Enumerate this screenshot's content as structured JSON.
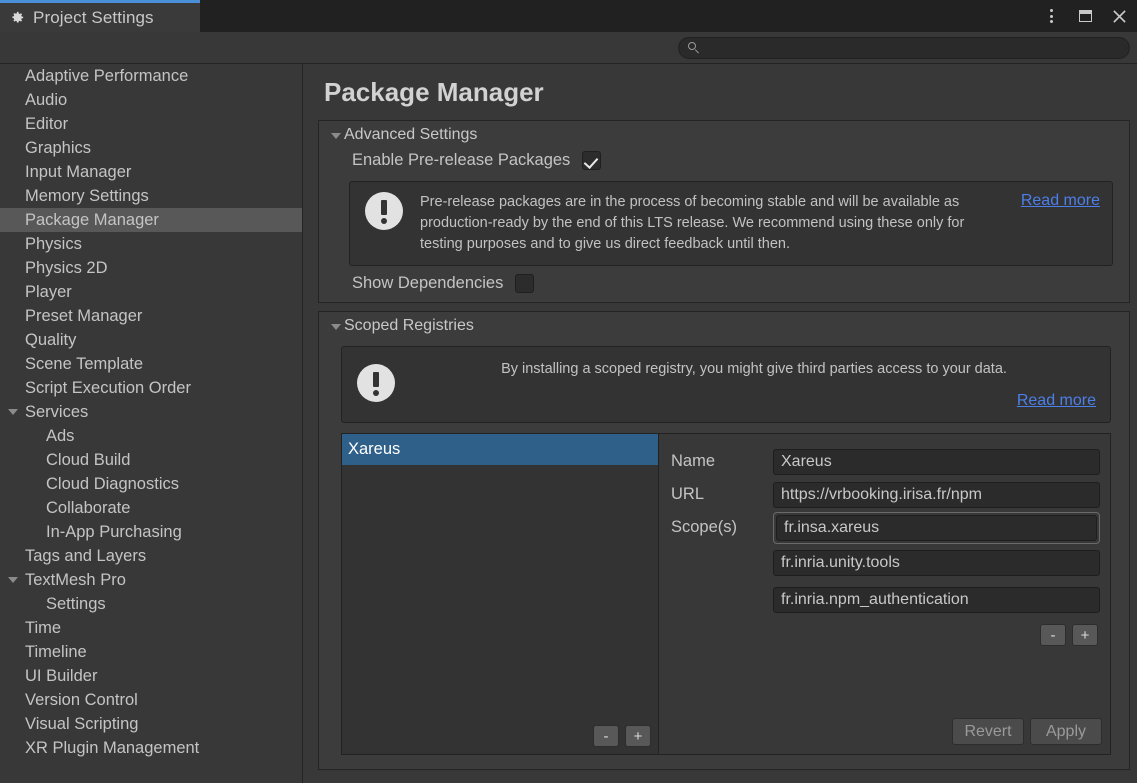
{
  "window": {
    "tab_label": "Project Settings",
    "tab_icon": "gear-icon",
    "controls": {
      "menu": "kebab-menu-icon",
      "maximize": "maximize-icon",
      "close": "close-icon"
    }
  },
  "search": {
    "icon": "search-icon",
    "value": "",
    "placeholder": ""
  },
  "sidebar": {
    "items": [
      {
        "label": "Adaptive Performance",
        "indent": 0,
        "selected": false,
        "foldout": false
      },
      {
        "label": "Audio",
        "indent": 0,
        "selected": false,
        "foldout": false
      },
      {
        "label": "Editor",
        "indent": 0,
        "selected": false,
        "foldout": false
      },
      {
        "label": "Graphics",
        "indent": 0,
        "selected": false,
        "foldout": false
      },
      {
        "label": "Input Manager",
        "indent": 0,
        "selected": false,
        "foldout": false
      },
      {
        "label": "Memory Settings",
        "indent": 0,
        "selected": false,
        "foldout": false
      },
      {
        "label": "Package Manager",
        "indent": 0,
        "selected": true,
        "foldout": false
      },
      {
        "label": "Physics",
        "indent": 0,
        "selected": false,
        "foldout": false
      },
      {
        "label": "Physics 2D",
        "indent": 0,
        "selected": false,
        "foldout": false
      },
      {
        "label": "Player",
        "indent": 0,
        "selected": false,
        "foldout": false
      },
      {
        "label": "Preset Manager",
        "indent": 0,
        "selected": false,
        "foldout": false
      },
      {
        "label": "Quality",
        "indent": 0,
        "selected": false,
        "foldout": false
      },
      {
        "label": "Scene Template",
        "indent": 0,
        "selected": false,
        "foldout": false
      },
      {
        "label": "Script Execution Order",
        "indent": 0,
        "selected": false,
        "foldout": false
      },
      {
        "label": "Services",
        "indent": 0,
        "selected": false,
        "foldout": true
      },
      {
        "label": "Ads",
        "indent": 1,
        "selected": false,
        "foldout": false
      },
      {
        "label": "Cloud Build",
        "indent": 1,
        "selected": false,
        "foldout": false
      },
      {
        "label": "Cloud Diagnostics",
        "indent": 1,
        "selected": false,
        "foldout": false
      },
      {
        "label": "Collaborate",
        "indent": 1,
        "selected": false,
        "foldout": false
      },
      {
        "label": "In-App Purchasing",
        "indent": 1,
        "selected": false,
        "foldout": false
      },
      {
        "label": "Tags and Layers",
        "indent": 0,
        "selected": false,
        "foldout": false
      },
      {
        "label": "TextMesh Pro",
        "indent": 0,
        "selected": false,
        "foldout": true
      },
      {
        "label": "Settings",
        "indent": 1,
        "selected": false,
        "foldout": false
      },
      {
        "label": "Time",
        "indent": 0,
        "selected": false,
        "foldout": false
      },
      {
        "label": "Timeline",
        "indent": 0,
        "selected": false,
        "foldout": false
      },
      {
        "label": "UI Builder",
        "indent": 0,
        "selected": false,
        "foldout": false
      },
      {
        "label": "Version Control",
        "indent": 0,
        "selected": false,
        "foldout": false
      },
      {
        "label": "Visual Scripting",
        "indent": 0,
        "selected": false,
        "foldout": false
      },
      {
        "label": "XR Plugin Management",
        "indent": 0,
        "selected": false,
        "foldout": false
      }
    ]
  },
  "main": {
    "page_title": "Package Manager",
    "advanced": {
      "foldout_label": "Advanced Settings",
      "expanded": true,
      "prerelease_label": "Enable Pre-release Packages",
      "prerelease_checked": true,
      "help_text": "Pre-release packages are in the process of becoming stable and will be available as production-ready by the end of this LTS release. We recommend using these only for testing purposes and to give us direct feedback until then.",
      "help_icon": "info-bubble-icon",
      "read_more": "Read more",
      "dependencies_label": "Show Dependencies",
      "dependencies_checked": false
    },
    "scoped": {
      "foldout_label": "Scoped Registries",
      "expanded": true,
      "help_text": "By installing a scoped registry, you might give third parties access to your data.",
      "help_icon": "info-bubble-icon",
      "read_more": "Read more",
      "registries": [
        {
          "name": "Xareus",
          "selected": true
        }
      ],
      "list_remove": "-",
      "list_add": "+",
      "form": {
        "name_label": "Name",
        "name_value": "Xareus",
        "url_label": "URL",
        "url_value": "https://vrbooking.irisa.fr/npm",
        "scopes_label": "Scope(s)",
        "scopes": [
          "fr.insa.xareus",
          "fr.inria.unity.tools",
          "fr.inria.npm_authentication"
        ],
        "scope_remove": "-",
        "scope_add": "+",
        "revert_label": "Revert",
        "apply_label": "Apply"
      }
    }
  },
  "colors": {
    "accent_blue": "#4a90d9",
    "selection_blue": "#2f6089",
    "link_blue": "#4d7fe8",
    "panel_bg": "#3c3c3c",
    "window_bg": "#383838"
  }
}
